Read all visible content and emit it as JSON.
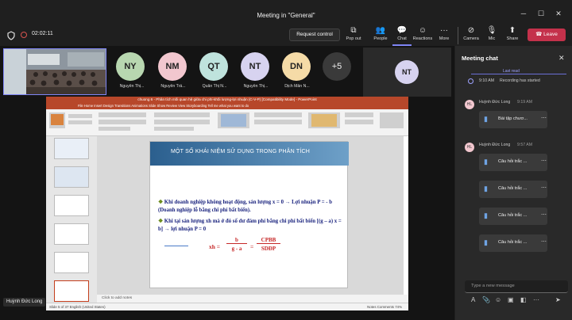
{
  "window": {
    "title": "Meeting in \"General\"",
    "minimize": "─",
    "maximize": "☐",
    "close": "✕"
  },
  "meeting": {
    "timer": "02:02:11"
  },
  "toolbar": {
    "request_control": "Request control",
    "pop_out": "Pop out",
    "people": "People",
    "chat": "Chat",
    "reactions": "Reactions",
    "more": "More",
    "camera": "Camera",
    "mic": "Mic",
    "share": "Share",
    "leave": "Leave"
  },
  "participants": [
    {
      "initials": "NY",
      "name": "Nguyễn Thị...",
      "color": "#b8d7b0"
    },
    {
      "initials": "NM",
      "name": "Nguyễn Trầ...",
      "color": "#f2c7cf"
    },
    {
      "initials": "QT",
      "name": "Quân Thị N...",
      "color": "#bfe3dd"
    },
    {
      "initials": "NT",
      "name": "Nguyễn Thị...",
      "color": "#d7d3f0"
    },
    {
      "initials": "DN",
      "name": "Dịch Mẫn N...",
      "color": "#f5dba7"
    }
  ],
  "overflow": {
    "label": "+5"
  },
  "big_avatar": {
    "initials": "NT",
    "color": "#d7d3f0"
  },
  "self_label": "Huỳnh Đức Long",
  "powerpoint": {
    "title": "chuong 6 - Phân tích mối quan hệ giữa chi phí-khối lượng-lợi nhuận (C-V-P) [Compatibility Mode] - PowerPoint",
    "tabs": "File   Home   Insert   Design   Transitions   Animations   Slide Show   Review   View   Storyboarding   Tell me what you want to do",
    "slide_heading": "MỘT SỐ KHÁI NIỆM SỬ DỤNG TRONG PHÂN TÍCH",
    "bullet1": "Khi doanh nghiệp không hoạt động, sản lượng x = 0 → Lợi nhuận P = - b (Doanh nghiệp lỗ bằng chi phí bất biến).",
    "bullet2": "Khi tại sản lượng xh mà ở đó số dư đảm phí bằng chi phí bất biến [(g – a) x = b] → lợi nhuận P = 0",
    "formula_left": "xh =",
    "formula_mid_num": "b",
    "formula_mid_den": "g - a",
    "formula_eq": "=",
    "formula_right_num": "CPBB",
    "formula_right_den": "SDĐP",
    "notes": "Click to add notes",
    "status_left": "Slide 5 of 37      English (United States)",
    "status_right": "Notes      Comments          74%"
  },
  "chat": {
    "title": "Meeting chat",
    "last_read": "Last read",
    "system_time": "9:10 AM",
    "system_text": "Recording has started",
    "messages": [
      {
        "sender": "Huỳnh Đức Long",
        "time": "9:19 AM",
        "files": [
          "Bài tập chươ..."
        ]
      },
      {
        "sender": "Huỳnh Đức Long",
        "time": "9:57 AM",
        "files": [
          "Câu hỏi trắc ...",
          "Câu hỏi trắc ...",
          "Câu hỏi trắc ...",
          "Câu hỏi trắc ..."
        ]
      }
    ],
    "input_placeholder": "Type a new message"
  }
}
